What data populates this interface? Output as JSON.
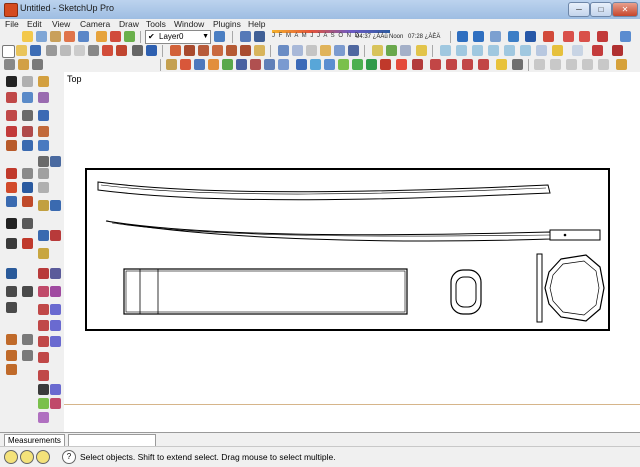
{
  "window": {
    "title": "Untitled - SketchUp Pro",
    "minimize": "─",
    "maximize": "□",
    "close": "✕"
  },
  "menu": [
    "File",
    "Edit",
    "View",
    "Camera",
    "Draw",
    "Tools",
    "Window",
    "Plugins",
    "Help"
  ],
  "layers": {
    "current": "Layer0"
  },
  "shadows": {
    "months": "J F M A M J J A S O N D",
    "time_start": "04:37 ¿ÀÀü",
    "noon": "Noon",
    "time_end": "07:28 ¿ÀÈÄ"
  },
  "viewport": {
    "view_name": "Top"
  },
  "measurements": {
    "label": "Measurements",
    "value": ""
  },
  "status": {
    "hint": "Select objects. Shift to extend select. Drag mouse to select multiple."
  },
  "colors": {
    "titlebar": "#9ebde2",
    "model_edge": "#000000",
    "ground_line": "#d6b58a"
  }
}
